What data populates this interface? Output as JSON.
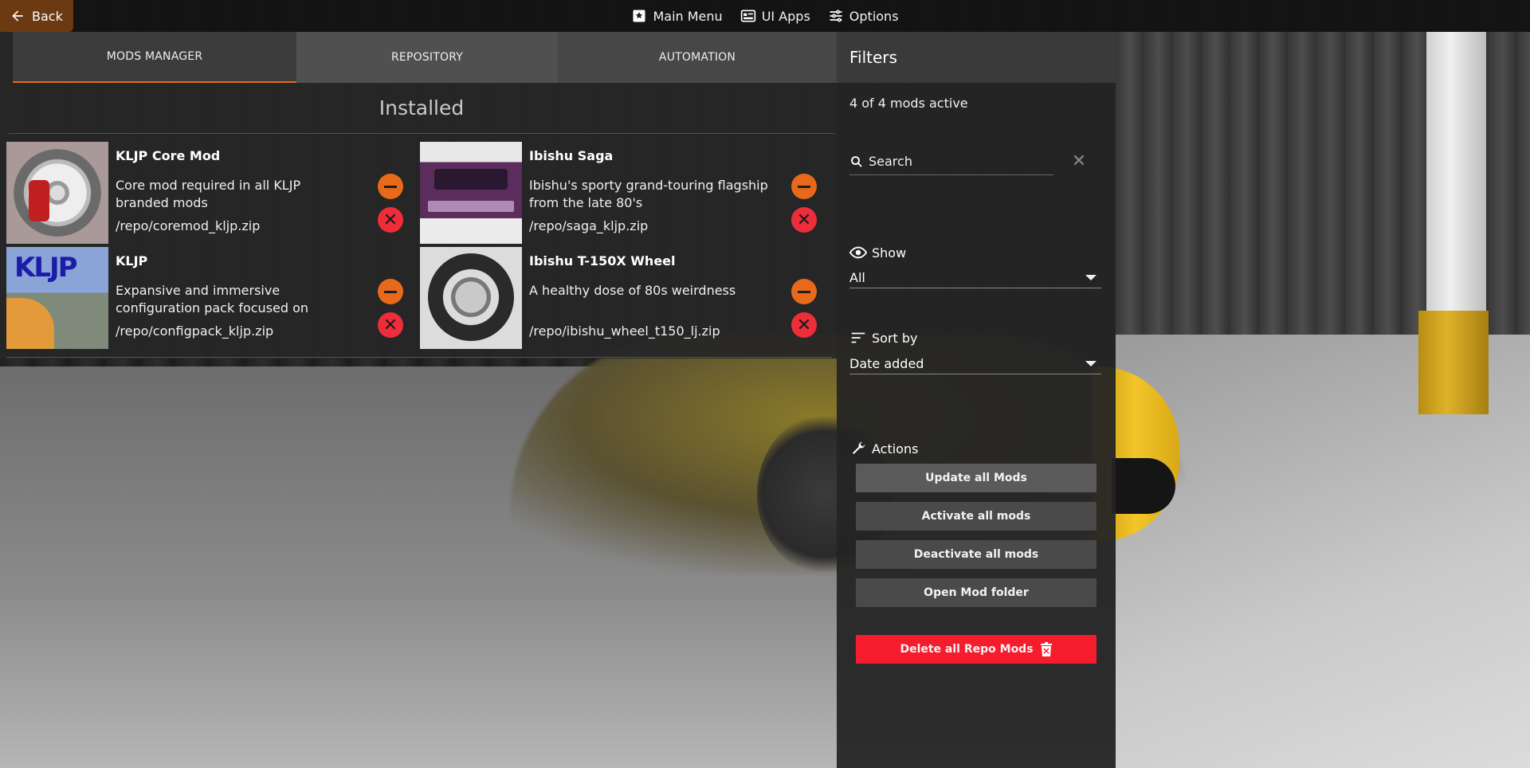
{
  "topbar": {
    "back_label": "Back",
    "items": [
      {
        "label": "Main Menu",
        "icon": "main-menu-icon"
      },
      {
        "label": "UI Apps",
        "icon": "ui-apps-icon"
      },
      {
        "label": "Options",
        "icon": "options-sliders-icon"
      }
    ]
  },
  "tabs": [
    "MODS MANAGER",
    "REPOSITORY",
    "AUTOMATION"
  ],
  "section_title": "Installed",
  "mods": [
    {
      "name": "KLJP Core Mod",
      "description": "Core mod required in all KLJP branded mods",
      "path": "/repo/coremod_kljp.zip"
    },
    {
      "name": "Ibishu Saga",
      "description": "Ibishu's sporty grand-touring flagship from the late 80's",
      "path": "/repo/saga_kljp.zip"
    },
    {
      "name": "KLJP",
      "description": "Expansive and immersive configuration pack focused on",
      "path": "/repo/configpack_kljp.zip"
    },
    {
      "name": "Ibishu T-150X Wheel",
      "description": "A healthy dose of 80s weirdness",
      "path": "/repo/ibishu_wheel_t150_lj.zip"
    }
  ],
  "filters": {
    "title": "Filters",
    "active_count": "4 of 4 mods active",
    "search_placeholder": "Search",
    "show_label": "Show",
    "show_value": "All",
    "sort_label": "Sort by",
    "sort_value": "Date added",
    "actions_label": "Actions",
    "actions": {
      "update_all": "Update all Mods",
      "activate_all": "Activate all mods",
      "deactivate_all": "Deactivate all mods",
      "open_folder": "Open Mod folder",
      "delete_all": "Delete all Repo Mods"
    }
  },
  "colors": {
    "accent_orange": "#e8691a",
    "danger_red": "#f51d2d",
    "panel_bg": "#262626"
  }
}
